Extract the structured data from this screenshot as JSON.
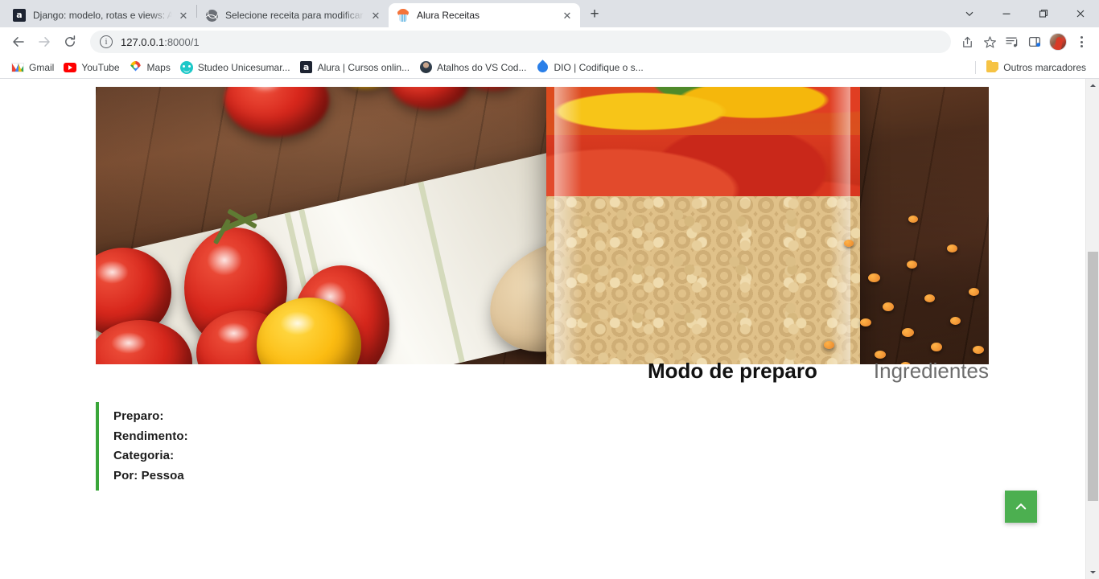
{
  "browser": {
    "tabs": [
      {
        "title": "Django: modelo, rotas e views: A",
        "favicon": "alura-icon",
        "active": false,
        "close_label": "✕"
      },
      {
        "title": "Selecione receita para modificar",
        "favicon": "globe-icon",
        "active": false,
        "close_label": "✕"
      },
      {
        "title": "Alura Receitas",
        "favicon": "cupcake-icon",
        "active": true,
        "close_label": "✕"
      }
    ],
    "new_tab_label": "+",
    "window_controls": {
      "tab_search": "chevron-down-icon",
      "minimize": "minimize-icon",
      "maximize": "maximize-icon",
      "close": "close-icon"
    },
    "toolbar": {
      "back": "back-arrow-icon",
      "forward": "forward-arrow-icon",
      "reload": "reload-icon",
      "site_info": "info-icon",
      "url_host": "127.0.0.1",
      "url_path": ":8000/1",
      "url_full": "127.0.0.1:8000/1",
      "share": "share-icon",
      "bookmark": "star-icon",
      "media": "media-control-icon",
      "side_panel": "side-panel-icon",
      "profile": "profile-avatar",
      "menu": "kebab-menu-icon"
    },
    "bookmarks": [
      {
        "label": "Gmail",
        "icon": "gmail-icon"
      },
      {
        "label": "YouTube",
        "icon": "youtube-icon"
      },
      {
        "label": "Maps",
        "icon": "maps-pin-icon"
      },
      {
        "label": "Studeo Unicesumar...",
        "icon": "studeo-icon"
      },
      {
        "label": "Alura | Cursos onlin...",
        "icon": "alura-icon"
      },
      {
        "label": "Atalhos do VS Cod...",
        "icon": "photo-avatar-icon"
      },
      {
        "label": "DIO | Codifique o s...",
        "icon": "dio-droplet-icon"
      }
    ],
    "other_bookmarks": {
      "label": "Outros marcadores",
      "icon": "folder-icon"
    }
  },
  "page": {
    "photo": {
      "alt": "Tomates, colher de madeira e pote de vidro com lentilhas"
    },
    "tabs": [
      {
        "label": "Modo de preparo",
        "active": true
      },
      {
        "label": "Ingredientes",
        "active": false
      }
    ],
    "details": [
      "Preparo:",
      "Rendimento:",
      "Categoria:",
      "Por: Pessoa"
    ],
    "scroll_top_button": {
      "icon": "chevron-up-icon",
      "color": "#4caf50"
    }
  },
  "colors": {
    "accent_green": "#3aa63a",
    "fab_green": "#4caf50",
    "tabstrip_bg": "#dee1e6",
    "omnibox_bg": "#f1f3f4",
    "active_tab_text": "#111111",
    "idle_tab_text": "#6d6d6d"
  }
}
